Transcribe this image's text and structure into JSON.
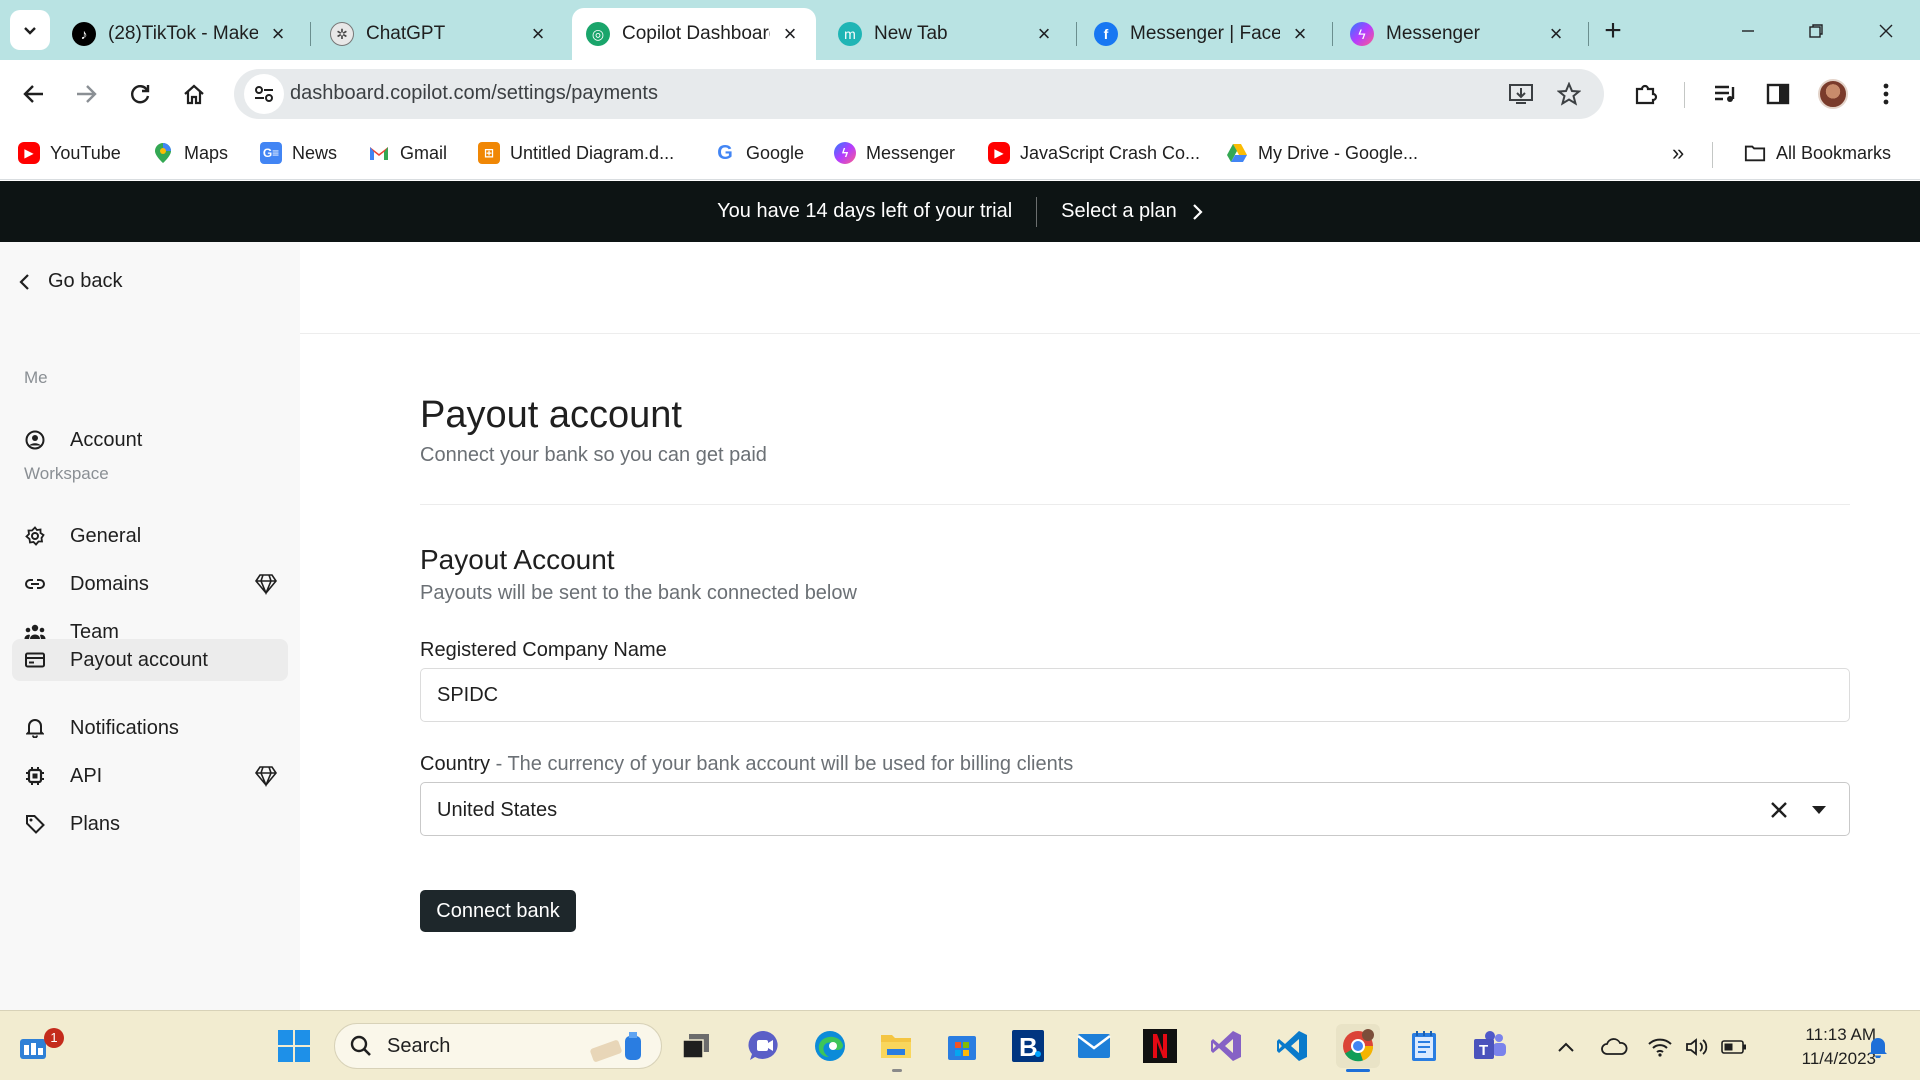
{
  "browser": {
    "tabs": [
      {
        "title": "(28)TikTok - Make",
        "icon": "tiktok-icon",
        "active": false
      },
      {
        "title": "ChatGPT",
        "icon": "chatgpt-icon",
        "active": false
      },
      {
        "title": "Copilot Dashboard",
        "icon": "copilot-icon",
        "active": true
      },
      {
        "title": "New Tab",
        "icon": "m-icon",
        "active": false
      },
      {
        "title": "Messenger | Faceb",
        "icon": "facebook-icon",
        "active": false
      },
      {
        "title": "Messenger",
        "icon": "messenger-icon",
        "active": false
      }
    ],
    "url": "dashboard.copilot.com/settings/payments",
    "bookmarks": [
      {
        "label": "YouTube",
        "icon": "youtube-icon"
      },
      {
        "label": "Maps",
        "icon": "maps-icon"
      },
      {
        "label": "News",
        "icon": "news-icon"
      },
      {
        "label": "Gmail",
        "icon": "gmail-icon"
      },
      {
        "label": "Untitled Diagram.d...",
        "icon": "drawio-icon"
      },
      {
        "label": "Google",
        "icon": "google-icon"
      },
      {
        "label": "Messenger",
        "icon": "messenger-icon"
      },
      {
        "label": "JavaScript Crash Co...",
        "icon": "youtube-icon"
      },
      {
        "label": "My Drive - Google...",
        "icon": "drive-icon"
      }
    ],
    "all_bookmarks": "All Bookmarks",
    "accent": "#b9e3e3"
  },
  "banner": {
    "trial_text": "You have 14 days left of your trial",
    "plan_link": "Select a plan"
  },
  "sidebar": {
    "go_back": "Go back",
    "me_label": "Me",
    "workspace_label": "Workspace",
    "items": [
      {
        "label": "Account",
        "icon": "user-circle-icon"
      },
      {
        "label": "General",
        "icon": "gear-icon"
      },
      {
        "label": "Domains",
        "icon": "link-icon",
        "premium": true
      },
      {
        "label": "Team",
        "icon": "team-icon"
      },
      {
        "label": "Payout account",
        "icon": "credit-card-icon",
        "active": true
      },
      {
        "label": "Notifications",
        "icon": "bell-icon"
      },
      {
        "label": "API",
        "icon": "chip-icon",
        "premium": true
      },
      {
        "label": "Plans",
        "icon": "tag-icon"
      }
    ]
  },
  "main": {
    "title": "Payout account",
    "subtitle": "Connect your bank so you can get paid",
    "section_title": "Payout Account",
    "section_subtitle": "Payouts will be sent to the bank connected below",
    "company_label": "Registered Company Name",
    "company_value": "SPIDC",
    "country_label": "Country",
    "country_hint": " - The currency of your bank account will be used for billing clients",
    "country_value": "United States",
    "connect_button": "Connect bank"
  },
  "taskbar": {
    "search_placeholder": "Search",
    "widgets_badge": "1",
    "time": "11:13 AM",
    "date": "11/4/2023"
  }
}
